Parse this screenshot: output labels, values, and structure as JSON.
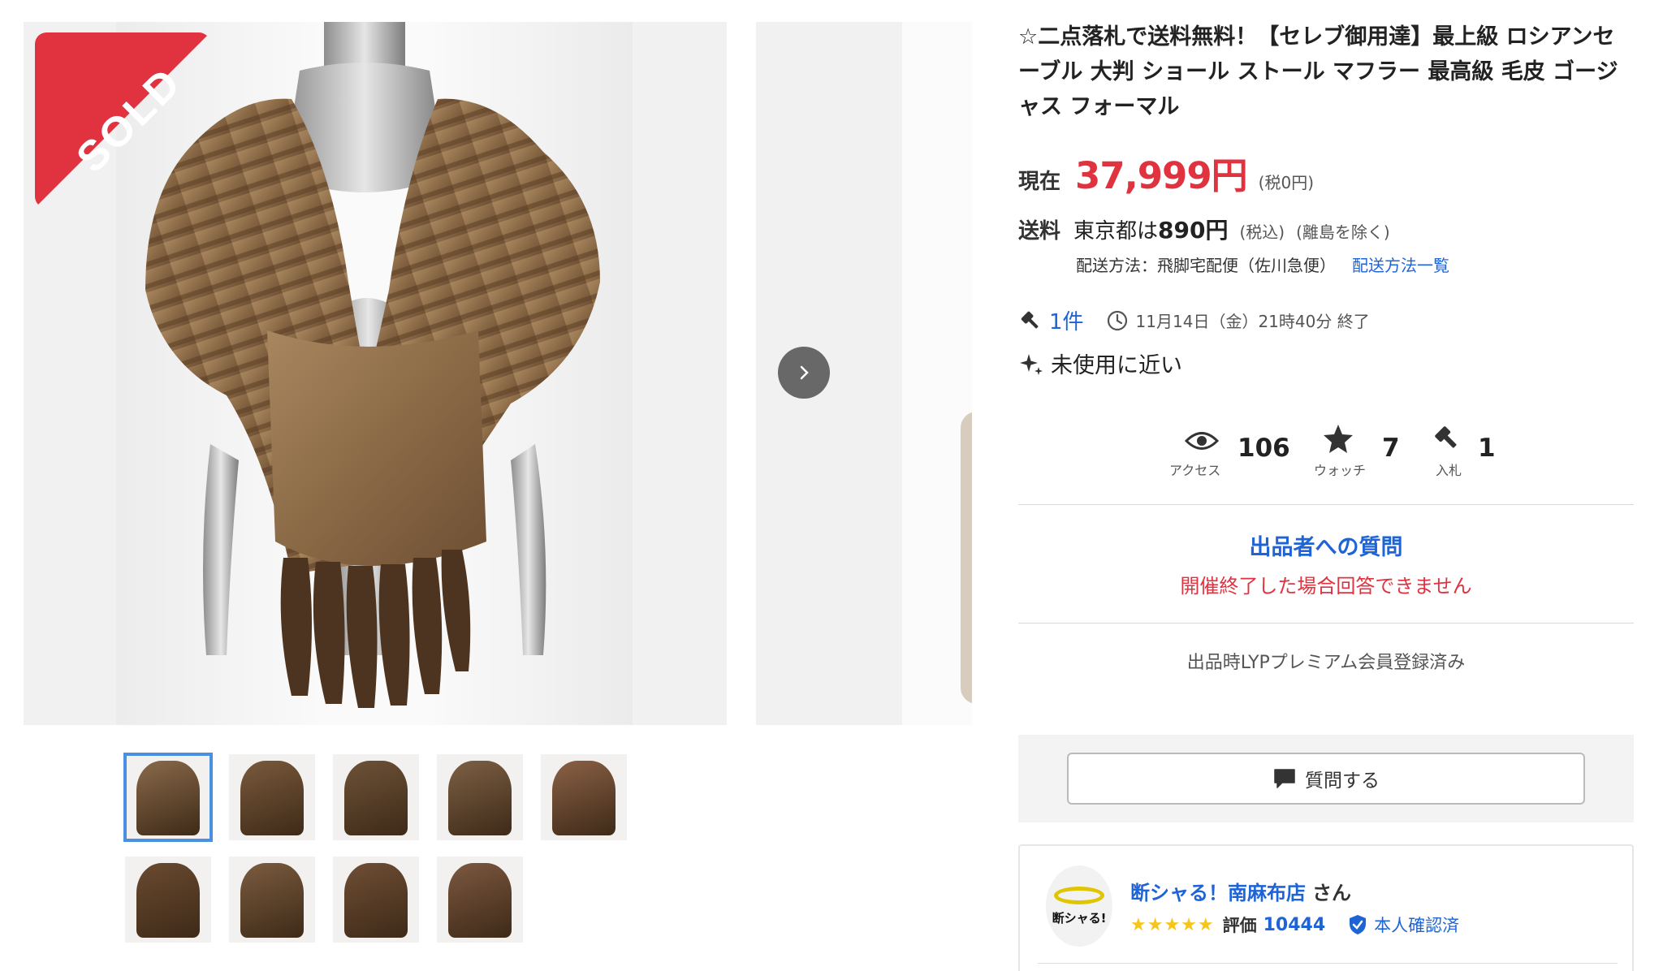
{
  "gallery": {
    "sold_label": "SOLD",
    "thumbnails": [
      {
        "color": "#8a6a4a"
      },
      {
        "color": "#7a5a3c"
      },
      {
        "color": "#6e5238"
      },
      {
        "color": "#7d6045"
      },
      {
        "color": "#8b6146"
      },
      {
        "color": "#6a4a30"
      },
      {
        "color": "#7b5c3f"
      },
      {
        "color": "#6f4e35"
      },
      {
        "color": "#7c5840"
      }
    ],
    "fur_colors": {
      "light": "#a8875f",
      "mid": "#8b6a47",
      "dark": "#5a3d24",
      "mannequin": "#bdbdbd"
    }
  },
  "item": {
    "title": "☆二点落札で送料無料！【セレブ御用達】最上級 ロシアンセーブル 大判 ショール ストール マフラー 最高級 毛皮 ゴージャス フォーマル",
    "price_label": "現在",
    "price": "37,999円",
    "price_tax": "(税0円)",
    "shipping_label": "送料",
    "shipping_dest": "東京都は",
    "shipping_amount": "890円",
    "shipping_tax": "(税込)",
    "shipping_exclusion": "(離島を除く)",
    "shipping_method": "配送方法：飛脚宅配便（佐川急便）",
    "shipping_methods_link": "配送方法一覧",
    "bid_count": "1件",
    "end_time": "11月14日（金）21時40分 終了",
    "condition": "未使用に近い"
  },
  "stats": {
    "access_label": "アクセス",
    "access": "106",
    "watch_label": "ウォッチ",
    "watch": "7",
    "bids_label": "入札",
    "bids": "1"
  },
  "question": {
    "title": "出品者への質問",
    "note": "開催終了した場合回答できません",
    "premium": "出品時LYPプレミアム会員登録済み",
    "ask_button": "質問する"
  },
  "seller": {
    "avatar_text": "断シャる!",
    "name": "断シャる！南麻布店",
    "suffix": "さん",
    "stars": "★★★★★",
    "rating_label": "評価",
    "rating": "10444",
    "verified": "本人確認済"
  },
  "colors": {
    "accent_blue": "#1e64d6",
    "price_red": "#e0323f",
    "sold_red": "#e0323f",
    "star_yellow": "#f5c518",
    "thumb_active": "#4a90e2"
  }
}
